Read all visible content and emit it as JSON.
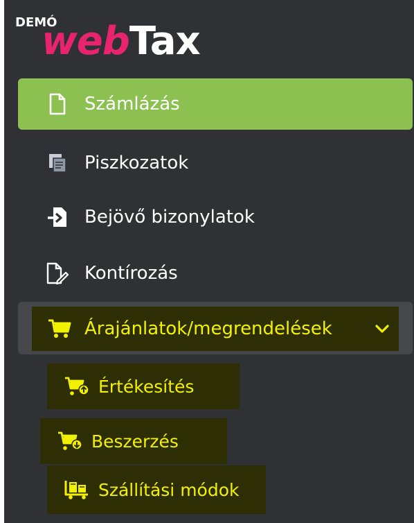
{
  "logo": {
    "demo": "DEMÓ",
    "web": "web",
    "tax": "Tax",
    "colors": {
      "web": "#e8246f",
      "tax": "#ffffff"
    }
  },
  "menu": {
    "items": [
      {
        "label": "Számlázás",
        "icon": "document-icon",
        "active": true
      },
      {
        "label": "Piszkozatok",
        "icon": "drafts-icon",
        "active": false
      },
      {
        "label": "Bejövő bizonylatok",
        "icon": "incoming-document-icon",
        "active": false
      },
      {
        "label": "Kontírozás",
        "icon": "document-edit-icon",
        "active": false
      }
    ],
    "group": {
      "label": "Árajánlatok/megrendelések",
      "icon": "cart-icon",
      "expanded": true,
      "children": [
        {
          "label": "Értékesítés",
          "icon": "cart-upload-icon"
        },
        {
          "label": "Beszerzés",
          "icon": "cart-download-icon"
        },
        {
          "label": "Szállítási módok",
          "icon": "shipping-cart-icon"
        }
      ]
    }
  },
  "colors": {
    "sidebar_bg": "#2f3134",
    "active_bg": "#8cc152",
    "highlight_bg": "#2e2e05",
    "highlight_text": "#f2f200",
    "group_band": "#45474a"
  }
}
